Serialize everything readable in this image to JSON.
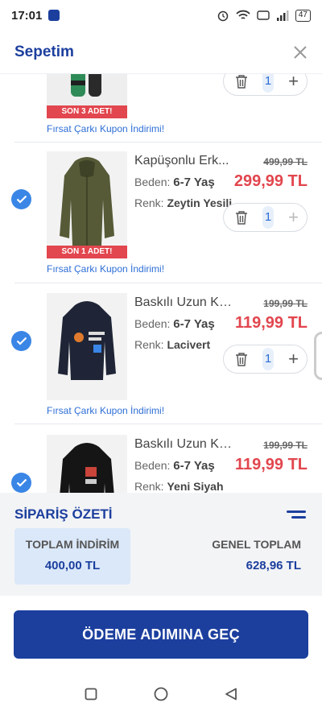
{
  "status_bar": {
    "time": "17:01",
    "battery": "47"
  },
  "header": {
    "title": "Sepetim"
  },
  "items": [
    {
      "stock_label": "SON 3 ADET!",
      "coupon": "Fırsat Çarkı Kupon İndirimi!",
      "qty": "1"
    },
    {
      "name": "Kapüşonlu Erk...",
      "old_price": "499,99 TL",
      "price": "299,99 TL",
      "size_label": "Beden:",
      "size": "6-7 Yaş",
      "color_label": "Renk:",
      "color": "Zeytin Yesili",
      "qty": "1",
      "stock_label": "SON 1 ADET!",
      "coupon": "Fırsat Çarkı Kupon İndirimi!"
    },
    {
      "name": "Baskılı Uzun Kol...",
      "old_price": "199,99 TL",
      "price": "119,99 TL",
      "size_label": "Beden:",
      "size": "6-7 Yaş",
      "color_label": "Renk:",
      "color": "Lacivert",
      "qty": "1",
      "coupon": "Fırsat Çarkı Kupon İndirimi!"
    },
    {
      "name": "Baskılı Uzun Kol...",
      "old_price": "199,99 TL",
      "price": "119,99 TL",
      "size_label": "Beden:",
      "size": "6-7 Yaş",
      "color_label": "Renk:",
      "color": "Yeni Siyah"
    }
  ],
  "summary": {
    "title": "SİPARİŞ ÖZETİ",
    "discount_label": "TOPLAM İNDİRİM",
    "discount_value": "400,00 TL",
    "total_label": "GENEL TOPLAM",
    "total_value": "628,96 TL"
  },
  "checkout_button": "ÖDEME ADIMINA GEÇ",
  "colors": {
    "brand": "#1c3f9e",
    "price_red": "#e2464e",
    "link_blue": "#2d6ed6",
    "check_blue": "#3a86e6"
  }
}
